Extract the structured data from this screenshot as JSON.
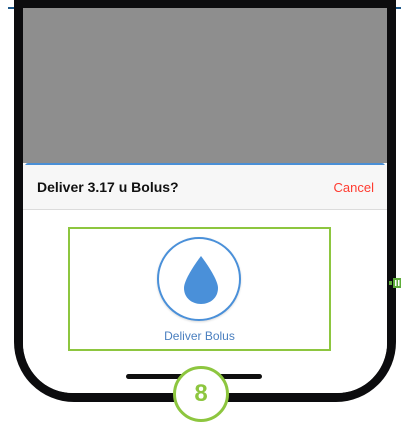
{
  "dialog": {
    "title": "Deliver 3.17 u Bolus?",
    "cancel_label": "Cancel",
    "deliver_label": "Deliver Bolus"
  },
  "step_badge": {
    "number": "8"
  },
  "icons": {
    "deliver": "water-drop-icon",
    "side": "battery-icon"
  },
  "colors": {
    "accent_blue": "#4a90d9",
    "highlight_green": "#8dc63f",
    "cancel_red": "#ff3b30"
  }
}
